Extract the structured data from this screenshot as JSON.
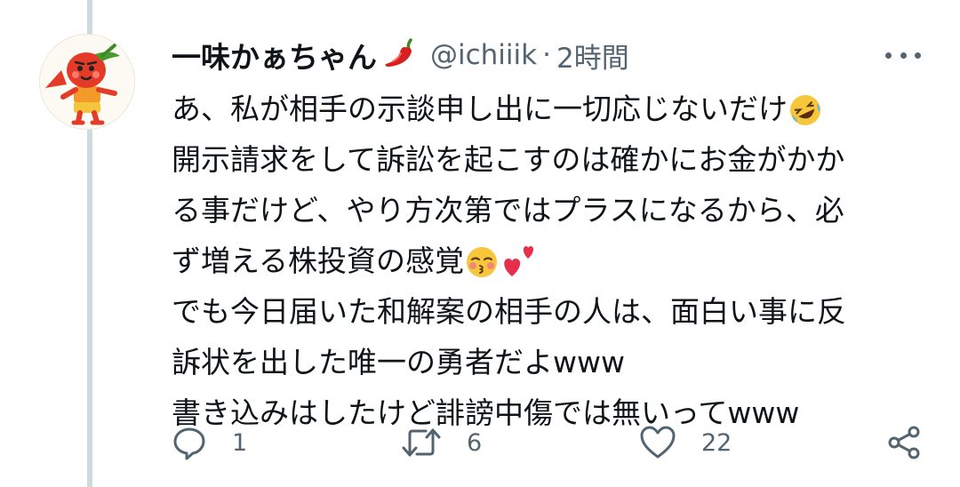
{
  "tweet": {
    "display_name": "一味かぁちゃん",
    "handle": "@ichiiik",
    "separator": "·",
    "timestamp": "2時間",
    "body_lines": [
      "あ、私が相手の示談申し出に一切応じないだけ",
      "開示請求をして訴訟を起こすのは確かにお金がかか",
      "る事だけど、やり方次第ではプラスになるから、必",
      "ず増える株投資の感覚",
      "でも今日届いた和解案の相手の人は、面白い事に反",
      "訴状を出した唯一の勇者だよwww",
      "書き込みはしたけど誹謗中傷では無いってwww"
    ],
    "emojis": {
      "after_name": "hot-pepper-emoji",
      "line1_end": "rolling-on-floor-laughing-emoji",
      "line4_end": [
        "kissing-face-emoji",
        "two-hearts-emoji"
      ]
    }
  },
  "actions": {
    "reply": {
      "icon": "reply-icon",
      "count": "1"
    },
    "retweet": {
      "icon": "retweet-icon",
      "count": "6"
    },
    "like": {
      "icon": "heart-icon",
      "count": "22"
    },
    "share": {
      "icon": "share-icon"
    }
  },
  "colors": {
    "text": "#0f1419",
    "secondary": "#536471",
    "thread_line": "#cfd9de",
    "background": "#ffffff"
  }
}
